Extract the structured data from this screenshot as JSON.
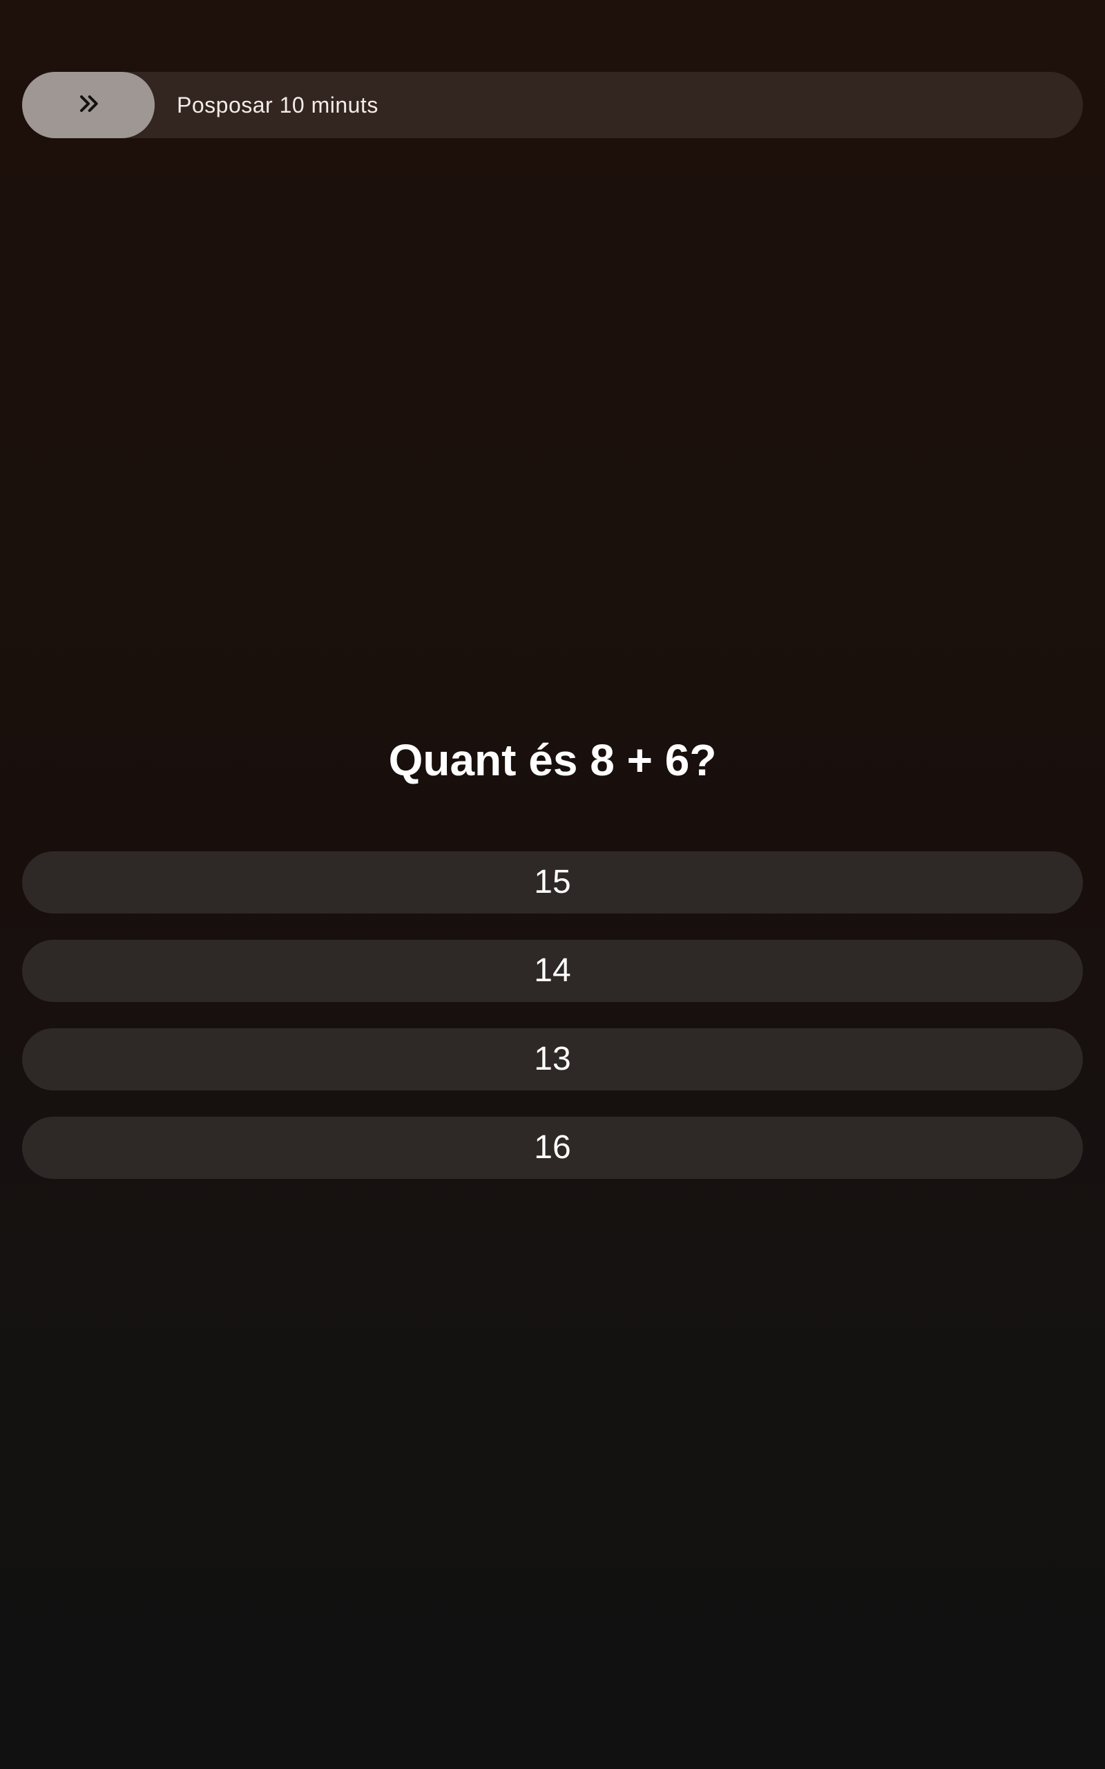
{
  "snooze": {
    "label": "Posposar 10 minuts",
    "handle_icon": "double-chevron-right-icon"
  },
  "quiz": {
    "question": "Quant és 8 + 6?",
    "answers": [
      {
        "label": "15"
      },
      {
        "label": "14"
      },
      {
        "label": "13"
      },
      {
        "label": "16"
      }
    ]
  },
  "colors": {
    "handle": "#9f9793",
    "track": "#33251f",
    "answer_bg": "#2e2826",
    "text": "#ffffff"
  }
}
